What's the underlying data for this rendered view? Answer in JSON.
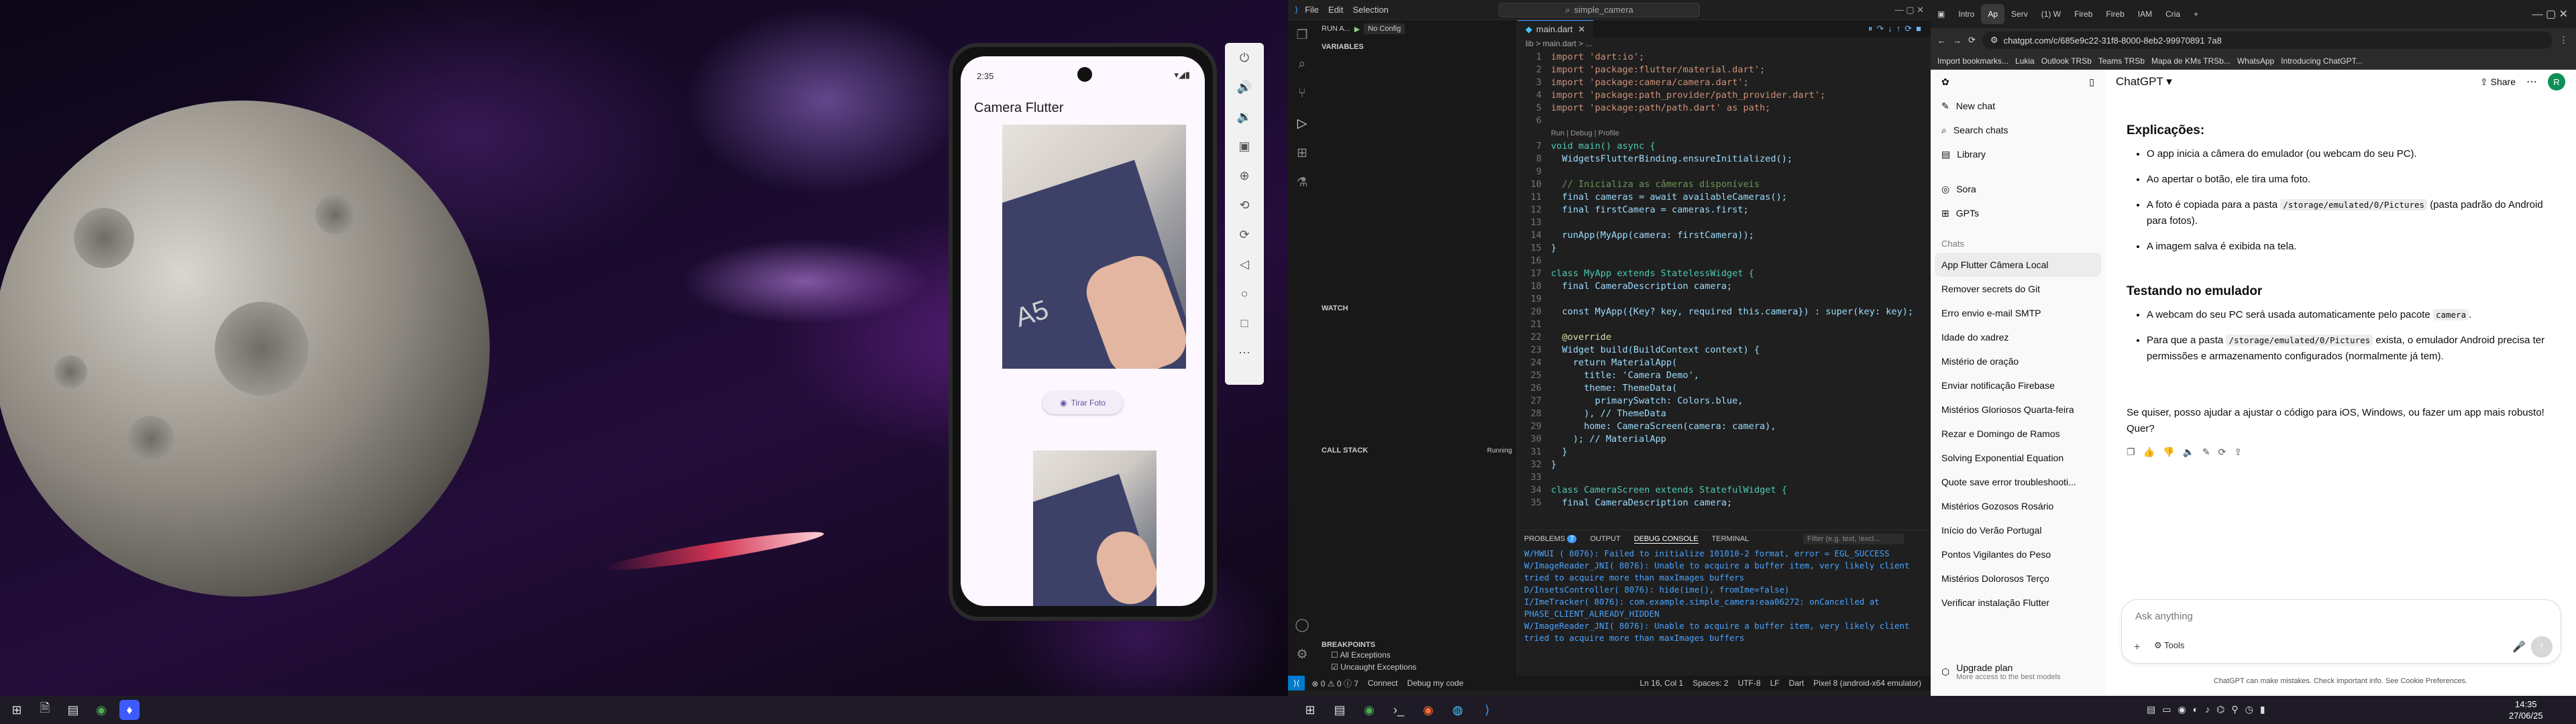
{
  "emulator": {
    "clock": "2:35",
    "app_title": "Camera Flutter",
    "button_label": "Tirar Foto",
    "brand_word": "A5"
  },
  "vscode": {
    "menu": [
      "File",
      "Edit",
      "Selection"
    ],
    "search": "simple_camera",
    "run_label": "RUN A...",
    "config": "No Config",
    "tab": "main.dart",
    "breadcrumb": "lib > main.dart > ...",
    "sections": {
      "variables": "VARIABLES",
      "watch": "WATCH",
      "call_stack": "CALL STACK",
      "call_stack_status": "Running",
      "breakpoints": "BREAKPOINTS"
    },
    "breakpoints": [
      "All Exceptions",
      "Uncaught Exceptions"
    ],
    "codelens": "Run | Debug | Profile",
    "code": [
      {
        "n": "1",
        "t": "import 'dart:io';"
      },
      {
        "n": "2",
        "t": "import 'package:flutter/material.dart';"
      },
      {
        "n": "3",
        "t": "import 'package:camera/camera.dart';"
      },
      {
        "n": "4",
        "t": "import 'package:path_provider/path_provider.dart';"
      },
      {
        "n": "5",
        "t": "import 'package:path/path.dart' as path;"
      },
      {
        "n": "6",
        "t": ""
      },
      {
        "n": "7",
        "t": "void main() async {"
      },
      {
        "n": "8",
        "t": "  WidgetsFlutterBinding.ensureInitialized();"
      },
      {
        "n": "9",
        "t": ""
      },
      {
        "n": "10",
        "t": "  // Inicializa as câmeras disponíveis"
      },
      {
        "n": "11",
        "t": "  final cameras = await availableCameras();"
      },
      {
        "n": "12",
        "t": "  final firstCamera = cameras.first;"
      },
      {
        "n": "13",
        "t": ""
      },
      {
        "n": "14",
        "t": "  runApp(MyApp(camera: firstCamera));"
      },
      {
        "n": "15",
        "t": "}"
      },
      {
        "n": "16",
        "t": ""
      },
      {
        "n": "17",
        "t": "class MyApp extends StatelessWidget {"
      },
      {
        "n": "18",
        "t": "  final CameraDescription camera;"
      },
      {
        "n": "19",
        "t": ""
      },
      {
        "n": "20",
        "t": "  const MyApp({Key? key, required this.camera}) : super(key: key);"
      },
      {
        "n": "21",
        "t": ""
      },
      {
        "n": "22",
        "t": "  @override"
      },
      {
        "n": "23",
        "t": "  Widget build(BuildContext context) {"
      },
      {
        "n": "24",
        "t": "    return MaterialApp("
      },
      {
        "n": "25",
        "t": "      title: 'Camera Demo',"
      },
      {
        "n": "26",
        "t": "      theme: ThemeData("
      },
      {
        "n": "27",
        "t": "        primarySwatch: Colors.blue,"
      },
      {
        "n": "28",
        "t": "      ), // ThemeData"
      },
      {
        "n": "29",
        "t": "      home: CameraScreen(camera: camera),"
      },
      {
        "n": "30",
        "t": "    ); // MaterialApp"
      },
      {
        "n": "31",
        "t": "  }"
      },
      {
        "n": "32",
        "t": "}"
      },
      {
        "n": "33",
        "t": ""
      },
      {
        "n": "34",
        "t": "class CameraScreen extends StatefulWidget {"
      },
      {
        "n": "35",
        "t": "  final CameraDescription camera;"
      }
    ],
    "panel_tabs": [
      "PROBLEMS",
      "OUTPUT",
      "DEBUG CONSOLE",
      "TERMINAL"
    ],
    "problems_count": "7",
    "filter_placeholder": "Filter (e.g. text, !excl...",
    "console": [
      "W/HWUI    ( 8076): Failed to initialize 101010-2 format, error = EGL_SUCCESS",
      "W/ImageReader_JNI( 8076): Unable to acquire a buffer item, very likely client tried to acquire more than maxImages buffers",
      "D/InsetsController( 8076): hide(ime(), fromIme=false)",
      "I/ImeTracker( 8076): com.example.simple_camera:eaa06272: onCancelled at PHASE_CLIENT_ALREADY_HIDDEN",
      "W/ImageReader_JNI( 8076): Unable to acquire a buffer item, very likely client tried to acquire more than maxImages buffers"
    ],
    "status": {
      "left": "⊗ 0 ⚠ 0  ⓘ 7",
      "connect": "Connect",
      "debug": "Debug my code",
      "pos": "Ln 16, Col 1",
      "spaces": "Spaces: 2",
      "enc": "UTF-8",
      "eol": "LF",
      "lang": "Dart",
      "device": "Pixel 8 (android-x64 emulator)"
    }
  },
  "browser": {
    "tabs": [
      "Intro",
      "Ap",
      "Serv",
      "(1) W",
      "Fireb",
      "Fireb",
      "IAM",
      "Cria"
    ],
    "url": "chatgpt.com/c/685e9c22-31f8-8000-8eb2-99970891 7a8",
    "bookmarks": [
      "Import bookmarks...",
      "Lukia",
      "Outlook TRSb",
      "Teams TRSb",
      "Mapa de KMs TRSb...",
      "WhatsApp",
      "Introducing ChatGPT..."
    ],
    "nav": [
      "New chat",
      "Search chats",
      "Library",
      "Sora",
      "GPTs"
    ],
    "chats_heading": "Chats",
    "chats": [
      "App Flutter Câmera Local",
      "Remover secrets do Git",
      "Erro envio e-mail SMTP",
      "Idade do xadrez",
      "Mistério de oração",
      "Enviar notificação Firebase",
      "Mistérios Gloriosos Quarta-feira",
      "Rezar e Domingo de Ramos",
      "Solving Exponential Equation",
      "Quote save error troubleshooti...",
      "Mistérios Gozosos Rosário",
      "Início do Verão Portugal",
      "Pontos Vigilantes do Peso",
      "Mistérios Dolorosos Terço",
      "Verificar instalação Flutter"
    ],
    "upgrade": "Upgrade plan",
    "upgrade_sub": "More access to the best models",
    "model": "ChatGPT",
    "share": "Share",
    "avatar": "R",
    "h1": "Explicações:",
    "bul1": [
      "O app inicia a câmera do emulador (ou webcam do seu PC).",
      "Ao apertar o botão, ele tira uma foto."
    ],
    "bul1c_pre": "A foto é copiada para a pasta",
    "bul1c_code": "/storage/emulated/0/Pictures",
    "bul1c_post": "(pasta padrão do Android para fotos).",
    "bul1d": "A imagem salva é exibida na tela.",
    "h2": "Testando no emulador",
    "bul2a_pre": "A webcam do seu PC será usada automaticamente pelo pacote",
    "bul2a_code": "camera",
    "bul2b_pre": "Para que a pasta",
    "bul2b_code": "/storage/emulated/0/Pictures",
    "bul2b_post": "exista, o emulador Android precisa ter permissões e armazenamento configurados (normalmente já tem).",
    "closing": "Se quiser, posso ajudar a ajustar o código para iOS, Windows, ou fazer um app mais robusto! Quer?",
    "input_placeholder": "Ask anything",
    "tools": "Tools",
    "footer": "ChatGPT can make mistakes. Check important info. See Cookie Preferences."
  },
  "clock": {
    "time": "14:35",
    "date": "27/06/25"
  }
}
